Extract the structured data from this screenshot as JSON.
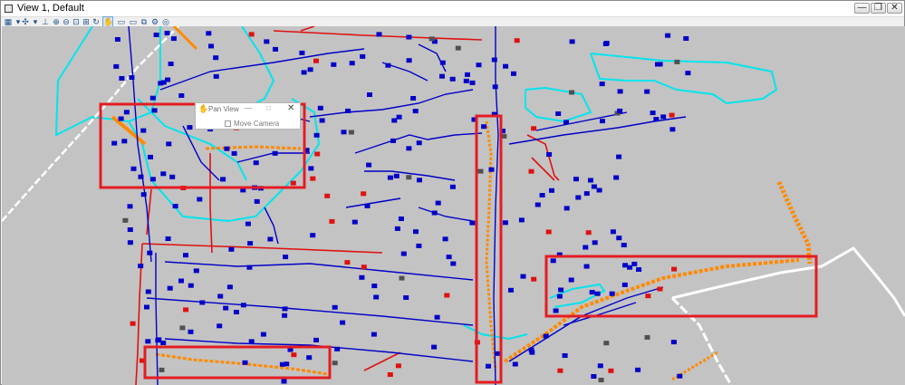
{
  "window": {
    "title": "View 1, Default",
    "controls": {
      "minimize": "—",
      "restore": "❐",
      "close": "✕"
    }
  },
  "toolbar": {
    "tools": [
      {
        "name": "view-attributes-icon",
        "glyph": "▦"
      },
      {
        "name": "dropdown-arrow-icon",
        "glyph": "▾"
      },
      {
        "name": "display-style-icon",
        "glyph": "✣"
      },
      {
        "name": "dropdown-arrow-icon",
        "glyph": "▾"
      },
      {
        "name": "update-view-icon",
        "glyph": "⊥"
      },
      {
        "name": "zoom-in-icon",
        "glyph": "⊕"
      },
      {
        "name": "zoom-out-icon",
        "glyph": "⊖"
      },
      {
        "name": "window-area-icon",
        "glyph": "⊡"
      },
      {
        "name": "fit-view-icon",
        "glyph": "⊞"
      },
      {
        "name": "rotate-view-icon",
        "glyph": "↻"
      },
      {
        "name": "pan-view-icon",
        "glyph": "✋",
        "selected": true
      },
      {
        "name": "view-previous-icon",
        "glyph": "▭"
      },
      {
        "name": "view-next-icon",
        "glyph": "▭"
      },
      {
        "name": "copy-view-icon",
        "glyph": "⧉"
      },
      {
        "name": "camera-icon",
        "glyph": "⚙"
      },
      {
        "name": "view-toggle-icon",
        "glyph": "◎"
      }
    ]
  },
  "pan_view_dialog": {
    "title": "Pan View",
    "minimize": "—",
    "maximize": "□",
    "close": "✕",
    "checkbox_label": "Move Camera",
    "checked": true
  },
  "colors": {
    "canvas": "#c3c3c3",
    "network_blue": "#0000c8",
    "network_red": "#e01010",
    "boundary_cyan": "#00e5ee",
    "highlight_orange": "#ff8a00",
    "road_white": "#ffffff",
    "annotation_box": "#e41c23"
  },
  "highlight_box_count": 5
}
